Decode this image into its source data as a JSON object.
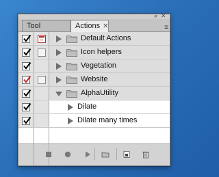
{
  "panel": {
    "tabs": [
      {
        "label": "Tool Presets",
        "active": false
      },
      {
        "label": "Actions",
        "active": true
      }
    ],
    "tab_close_glyph": "✕",
    "window_close_glyph": "✕",
    "collapse_glyph": "«",
    "menu_glyph": "≡"
  },
  "actions": [
    {
      "label": "Default Actions",
      "type": "set",
      "expanded": false,
      "checked": true,
      "check_color": "#000000",
      "dialog": "on"
    },
    {
      "label": "Icon helpers",
      "type": "set",
      "expanded": false,
      "checked": true,
      "check_color": "#000000",
      "dialog": "off"
    },
    {
      "label": "Vegetation",
      "type": "set",
      "expanded": false,
      "checked": true,
      "check_color": "#000000",
      "dialog": "none"
    },
    {
      "label": "Website",
      "type": "set",
      "expanded": false,
      "checked": true,
      "check_color": "#c0252d",
      "dialog": "off"
    },
    {
      "label": "AlphaUtility",
      "type": "set",
      "expanded": true,
      "checked": true,
      "check_color": "#000000",
      "dialog": "none"
    },
    {
      "label": "Dilate",
      "type": "action",
      "expanded": false,
      "checked": true,
      "check_color": "#000000",
      "dialog": "none"
    },
    {
      "label": "Dilate many times",
      "type": "action",
      "expanded": false,
      "checked": true,
      "check_color": "#000000",
      "dialog": "none"
    }
  ],
  "toolbar_icons": [
    "stop-icon",
    "record-icon",
    "play-icon",
    "new-set-icon",
    "new-action-icon",
    "delete-icon"
  ],
  "colors": {
    "desktop": "#2f6fb5",
    "panel": "#d6d6d6",
    "red_check": "#c0252d"
  }
}
